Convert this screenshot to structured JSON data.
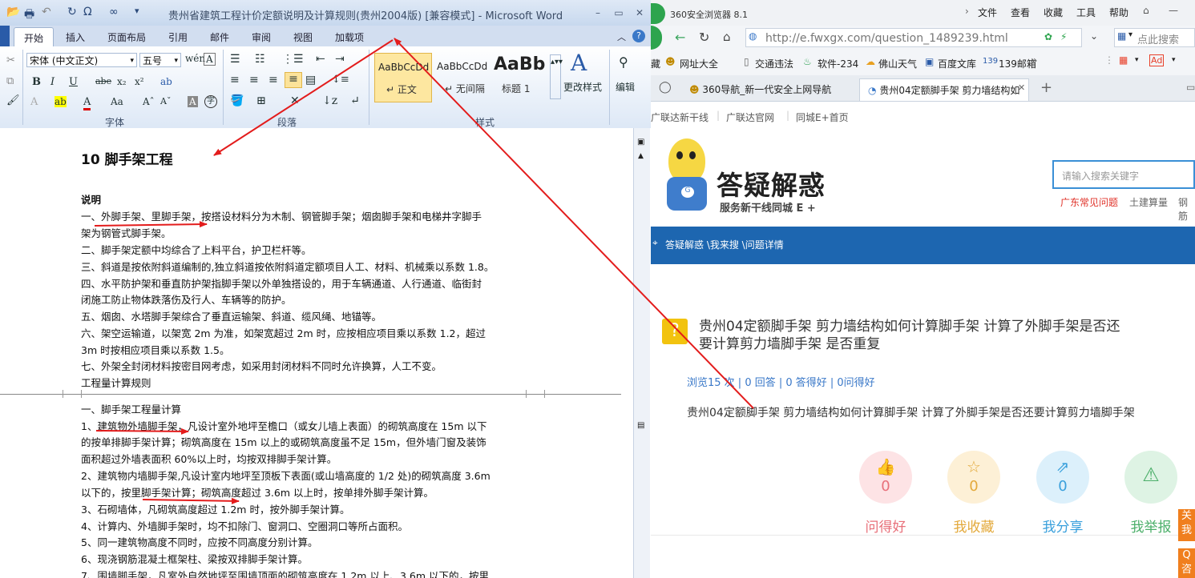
{
  "word": {
    "title": "贵州省建筑工程计价定额说明及计算规则(贵州2004版) [兼容模式] - Microsoft Word",
    "tabs": [
      "开始",
      "插入",
      "页面布局",
      "引用",
      "邮件",
      "审阅",
      "视图",
      "加载项"
    ],
    "font_name": "宋体 (中文正文)",
    "font_size": "五号",
    "group_labels": {
      "font": "字体",
      "paragraph": "段落",
      "styles": "样式"
    },
    "styles": [
      {
        "sample": "AaBbCcDd",
        "name": "↵ 正文"
      },
      {
        "sample": "AaBbCcDd",
        "name": "↵ 无间隔"
      },
      {
        "sample": "AaBb",
        "name": "标题 1"
      }
    ],
    "change_styles": "更改样式",
    "edit": "编辑",
    "doc": {
      "title": "10  脚手架工程",
      "lines": [
        "说明",
        "一、外脚手架、里脚手架，按搭设材料分为木制、钢管脚手架；烟囱脚手架和电梯井字脚手",
        "架为钢管式脚手架。",
        "二、脚手架定额中均综合了上料平台，护卫栏杆等。",
        "三、斜道是按依附斜道编制的,独立斜道按依附斜道定额项目人工、材料、机械乘以系数 1.8。",
        "四、水平防护架和垂直防护架指脚手架以外单独搭设的，用于车辆通道、人行通道、临街封",
        "闭施工防止物体跌落伤及行人、车辆等的防护。",
        "五、烟囱、水塔脚手架综合了垂直运输架、斜道、缆风绳、地锚等。",
        "六、架空运输道，以架宽 2m 为准，如架宽超过 2m 时，应按相应项目乘以系数 1.2，超过",
        "3m 时按相应项目乘以系数 1.5。",
        "七、外架全封闭材料按密目网考虑，如采用封闭材料不同时允许换算，人工不变。",
        "工程量计算规则"
      ],
      "lines2": [
        "一、脚手架工程量计算",
        "1、建筑物外墙脚手架，凡设计室外地坪至檐口（或女儿墙上表面）的砌筑高度在 15m 以下",
        "的按单排脚手架计算；砌筑高度在 15m 以上的或砌筑高度虽不足 15m，但外墙门窗及装饰",
        "面积超过外墙表面积 60%以上时，均按双排脚手架计算。",
        "2、建筑物内墙脚手架,凡设计室内地坪至顶板下表面(或山墙高度的  1/2 处)的砌筑高度 3.6m",
        "以下的，按里脚手架计算；砌筑高度超过 3.6m 以上时，按单排外脚手架计算。",
        "3、石砌墙体，凡砌筑高度超过 1.2m 时，按外脚手架计算。",
        "4、计算内、外墙脚手架时，均不扣除门、窗洞口、空圈洞口等所占面积。",
        "5、同一建筑物高度不同时，应按不同高度分别计算。",
        "6、现浇钢筋混凝土框架柱、梁按双排脚手架计算。",
        "7、围墙脚手架，凡室外自然地坪至围墙顶面的砌筑高度在 1.2m 以上、3.6m 以下的，按里"
      ]
    }
  },
  "browser": {
    "title": "360安全浏览器 8.1",
    "menu": [
      "文件",
      "查看",
      "收藏",
      "工具",
      "帮助"
    ],
    "url": "http://e.fwxgx.com/question_1489239.html",
    "search_placeholder": "点此搜索",
    "bookmarks": [
      "藏",
      "网址大全",
      "交通违法",
      "软件-234",
      "佛山天气",
      "百度文库",
      "139邮箱"
    ],
    "tabs": [
      "360导航_新一代安全上网导航",
      "贵州04定额脚手架 剪力墙结构如"
    ],
    "toplinks": [
      "广联达新干线",
      "广联达官网",
      "同城E+首页"
    ],
    "site": {
      "logo_title": "答疑解惑",
      "logo_sub": "服务新干线同城 E +",
      "search_placeholder": "请输入搜索关键字",
      "hot_links": [
        "广东常见问题",
        "土建算量",
        "钢筋"
      ],
      "breadcrumb": "答疑解惑 \\我来搜 \\问题详情",
      "question_title_1": "贵州04定额脚手架 剪力墙结构如何计算脚手架 计算了外脚手架是否还",
      "question_title_2": "要计算剪力墙脚手架 是否重复",
      "stats": "浏览15 次 | 0 回答 | 0 答得好 | 0问得好",
      "question_body": "贵州04定额脚手架 剪力墙结构如何计算脚手架  计算了外脚手架是否还要计算剪力墙脚手架",
      "actions": [
        {
          "label": "问得好",
          "count": "0",
          "icon": "thumb-up-icon",
          "color": "#e8707a",
          "bg": "#fde3e5"
        },
        {
          "label": "我收藏",
          "count": "0",
          "icon": "star-icon",
          "color": "#e3a93b",
          "bg": "#fdf0d6"
        },
        {
          "label": "我分享",
          "count": "0",
          "icon": "share-icon",
          "color": "#3aa0dc",
          "bg": "#dcf0fb"
        },
        {
          "label": "我举报",
          "count": "",
          "icon": "warning-icon",
          "color": "#4caf6a",
          "bg": "#def3e4"
        }
      ],
      "side_tabs": [
        "关我",
        "Q咨"
      ]
    }
  }
}
